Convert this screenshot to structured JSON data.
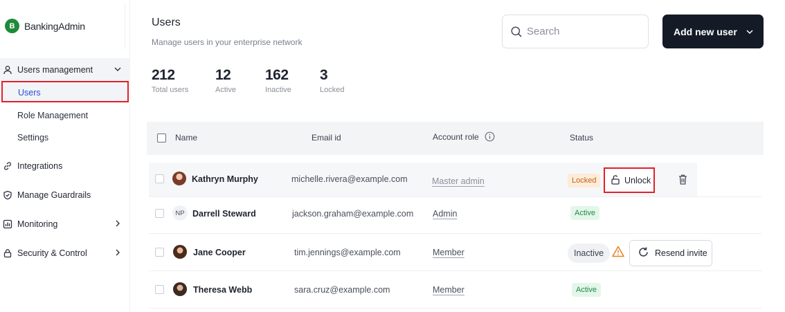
{
  "brand": {
    "logo_letter": "B",
    "name": "BankingAdmin",
    "logo_color": "#1e8a3a"
  },
  "sidebar": {
    "groups": [
      {
        "label": "Users management",
        "icon": "user-icon",
        "expanded": true,
        "children": [
          {
            "label": "Users",
            "selected": true
          },
          {
            "label": "Role Management"
          },
          {
            "label": "Settings"
          }
        ]
      },
      {
        "label": "Integrations",
        "icon": "link-icon"
      },
      {
        "label": "Manage Guardrails",
        "icon": "shield-icon"
      },
      {
        "label": "Monitoring",
        "icon": "chart-icon",
        "expandable": true
      },
      {
        "label": "Security & Control",
        "icon": "lock-icon",
        "expandable": true
      }
    ]
  },
  "header": {
    "title": "Users",
    "subtitle": "Manage users in your enterprise network"
  },
  "search": {
    "placeholder": "Search"
  },
  "add_button": {
    "label": "Add new user"
  },
  "stats": [
    {
      "value": "212",
      "caption": "Total users"
    },
    {
      "value": "12",
      "caption": "Active"
    },
    {
      "value": "162",
      "caption": "Inactive"
    },
    {
      "value": "3",
      "caption": "Locked"
    }
  ],
  "table": {
    "columns": {
      "name": "Name",
      "email": "Email id",
      "role": "Account role",
      "status": "Status"
    },
    "rows": [
      {
        "name": "Kathryn Murphy",
        "email": "michelle.rivera@example.com",
        "role": "Master admin",
        "status": "Locked",
        "action": "Unlock"
      },
      {
        "name": "Darrell Steward",
        "initials": "NP",
        "email": "jackson.graham@example.com",
        "role": "Admin",
        "status": "Active"
      },
      {
        "name": "Jane Cooper",
        "email": "tim.jennings@example.com",
        "role": "Member",
        "status": "Inactive",
        "action": "Resend invite"
      },
      {
        "name": "Theresa Webb",
        "email": "sara.cruz@example.com",
        "role": "Member",
        "status": "Active"
      }
    ]
  },
  "colors": {
    "accent": "#2a4fd6",
    "highlight": "#e0202a",
    "locked": "#c4621a",
    "active": "#1f8a45",
    "primary_button": "#141a26"
  }
}
